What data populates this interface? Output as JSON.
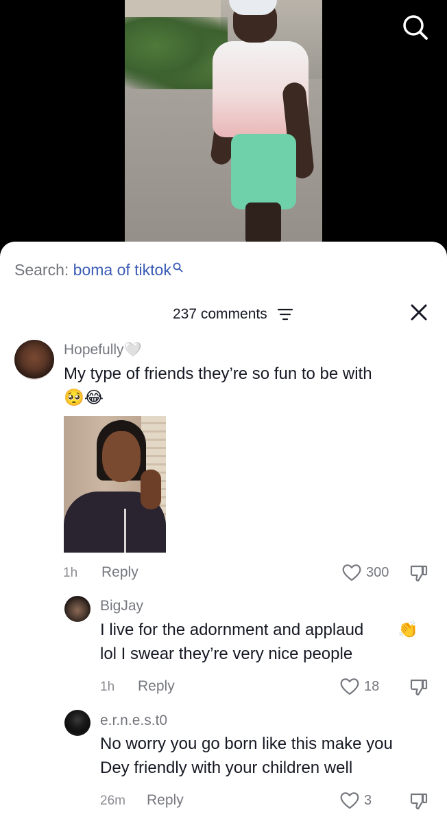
{
  "video": {
    "search_icon": "search-icon"
  },
  "search": {
    "prefix": "Search:",
    "query": "boma of tiktok",
    "icon": "search-icon"
  },
  "comments_header": {
    "count_label": "237 comments",
    "filter_icon": "filter-icon",
    "close_icon": "close-icon"
  },
  "comments": [
    {
      "username": "Hopefully🤍",
      "text": "My type of friends they’re so fun to be with",
      "emojis": "🥺😂",
      "time": "1h",
      "reply_label": "Reply",
      "likes": "300"
    },
    {
      "username": "BigJay",
      "text_line1": "I live for the adornment and applaud",
      "text_line2": "lol I swear they’re very nice people",
      "emoji": "👏",
      "time": "1h",
      "reply_label": "Reply",
      "likes": "18"
    },
    {
      "username": "e.r.n.e.s.t0",
      "text_line1": "No worry you go born like this make you",
      "text_line2": "Dey friendly with your children well",
      "time": "26m",
      "reply_label": "Reply",
      "likes": "3"
    }
  ],
  "colors": {
    "link_blue": "#3b5bb5",
    "muted_gray": "#75777e",
    "text_dark": "#161823"
  }
}
